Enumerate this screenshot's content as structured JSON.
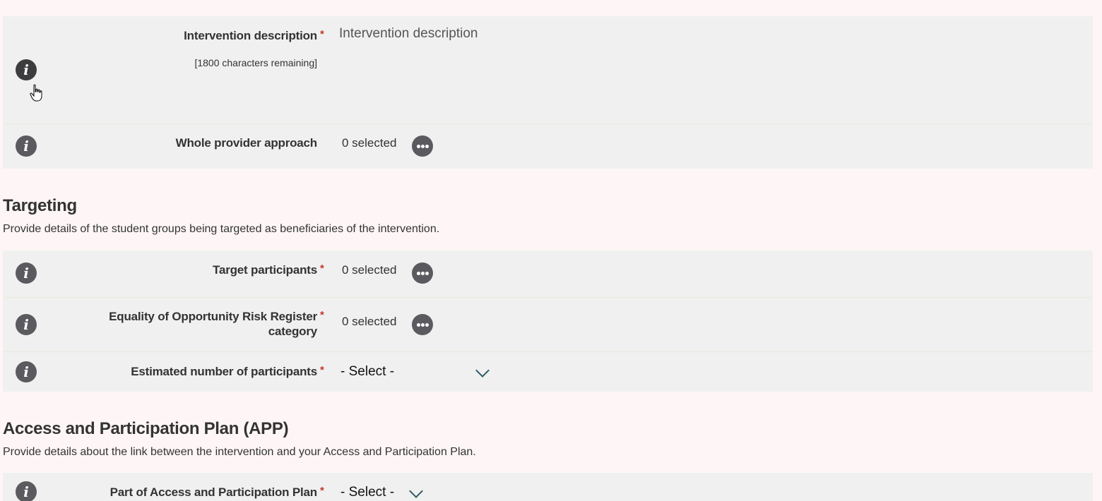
{
  "panel_top": {
    "intervention_description": {
      "label": "Intervention description",
      "required_mark": "*",
      "chars_remaining": "[1800 characters remaining]",
      "placeholder": "Intervention description",
      "info_icon": "info-icon"
    },
    "whole_provider_approach": {
      "label": "Whole provider approach",
      "value": "0 selected",
      "more_icon": "ellipsis-icon",
      "info_icon": "info-icon"
    }
  },
  "targeting": {
    "title": "Targeting",
    "description": "Provide details of the student groups being targeted as beneficiaries of the intervention.",
    "rows": {
      "target_participants": {
        "label": "Target participants",
        "required_mark": "*",
        "value": "0 selected"
      },
      "risk_register": {
        "label_line1": "Equality of Opportunity Risk Register",
        "label_line2": "category",
        "required_mark": "*",
        "value": "0 selected"
      },
      "estimated_participants": {
        "label": "Estimated number of participants",
        "required_mark": "*",
        "selected": "- Select -"
      }
    }
  },
  "app": {
    "title": "Access and Participation Plan (APP)",
    "description": "Provide details about the link between the intervention and your Access and Participation Plan.",
    "rows": {
      "part_of_app": {
        "label": "Part of Access and Participation Plan",
        "required_mark": "*",
        "selected": "- Select -"
      }
    }
  },
  "colors": {
    "page_bg": "#fef6f6",
    "panel_bg": "#f0f0f0",
    "icon_bg": "#5b5a5e",
    "required": "#c0392b",
    "chevron": "#2f5a64"
  }
}
